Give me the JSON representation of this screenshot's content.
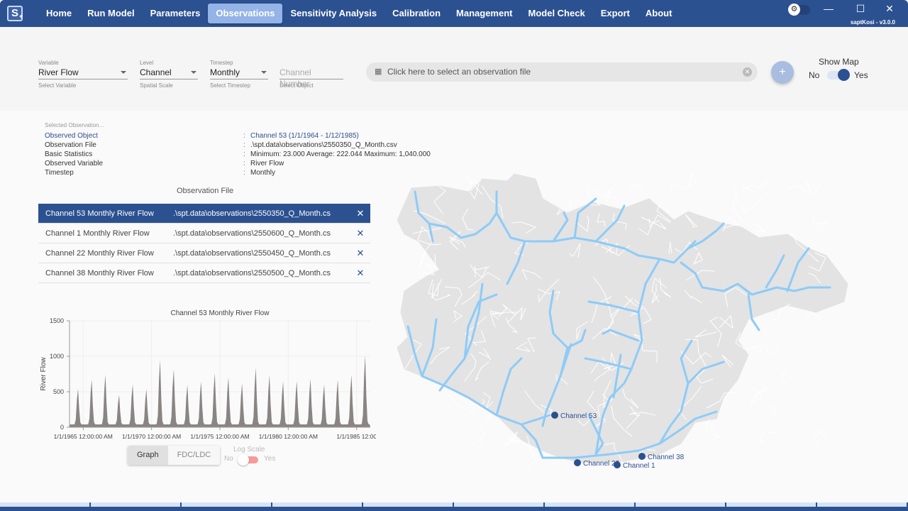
{
  "app": {
    "icon": "app-logo-s",
    "version_label": "saptKosi  - v3.0.0"
  },
  "nav": {
    "items": [
      {
        "label": "Home",
        "active": false
      },
      {
        "label": "Run Model",
        "active": false
      },
      {
        "label": "Parameters",
        "active": false
      },
      {
        "label": "Observations",
        "active": true
      },
      {
        "label": "Sensitivity Analysis",
        "active": false
      },
      {
        "label": "Calibration",
        "active": false
      },
      {
        "label": "Management",
        "active": false
      },
      {
        "label": "Model Check",
        "active": false
      },
      {
        "label": "Export",
        "active": false
      },
      {
        "label": "About",
        "active": false
      }
    ]
  },
  "window_controls": {
    "minimize": "—",
    "maximize": "☐",
    "close": "✕",
    "theme_icon": "gear-icon"
  },
  "filters": {
    "variable": {
      "label": "Variable",
      "value": "River Flow",
      "hint": "Select Variable"
    },
    "level": {
      "label": "Level",
      "value": "Channel",
      "hint": "Spatial Scale"
    },
    "timestep": {
      "label": "Timestep",
      "value": "Monthly",
      "hint": "Select Timestep"
    },
    "object": {
      "placeholder": "Channel Number",
      "hint": "Select Object"
    },
    "file_placeholder": "Click here to select an observation file",
    "add_label": "+",
    "show_map": {
      "label": "Show Map",
      "no": "No",
      "yes": "Yes",
      "value": true
    }
  },
  "selected": {
    "title": "Selected Observation...",
    "rows": [
      {
        "key": "Observed Object",
        "value": "Channel 53  (1/1/1964 - 1/12/1985)"
      },
      {
        "key": "Observation File",
        "value": ".\\spt.data\\observations\\2550350_Q_Month.csv"
      },
      {
        "key": "Basic Statistics",
        "value": "Minimum: 23.000 Average: 222.044 Maximum: 1,040.000"
      },
      {
        "key": "Observed Variable",
        "value": "River Flow"
      },
      {
        "key": "Timestep",
        "value": "Monthly"
      }
    ]
  },
  "obs_table": {
    "header": "Observation File",
    "rows": [
      {
        "name": "Channel 53 Monthly River Flow",
        "file": ".\\spt.data\\observations\\2550350_Q_Month.cs",
        "selected": true
      },
      {
        "name": "Channel 1 Monthly River Flow",
        "file": ".\\spt.data\\observations\\2550600_Q_Month.cs",
        "selected": false
      },
      {
        "name": "Channel 22 Monthly River Flow",
        "file": ".\\spt.data\\observations\\2550450_Q_Month.cs",
        "selected": false
      },
      {
        "name": "Channel 38 Monthly River Flow",
        "file": ".\\spt.data\\observations\\2550500_Q_Month.cs",
        "selected": false
      }
    ],
    "remove_icon": "✕"
  },
  "chart_controls": {
    "graph": "Graph",
    "fdc": "FDC/LDC",
    "log_label": "Log Scale",
    "log_no": "No",
    "log_yes": "Yes",
    "log_value": false
  },
  "chart_data": {
    "type": "area",
    "title": "Channel 53 Monthly River Flow",
    "xlabel": "",
    "ylabel": "River Flow",
    "ylim": [
      0,
      1500
    ],
    "yticks": [
      0,
      500,
      1000,
      1500
    ],
    "xticks": [
      "1/1/1965 12:00:00 AM",
      "1/1/1970 12:00:00 AM",
      "1/1/1975 12:00:00 AM",
      "1/1/1980 12:00:00 AM",
      "1/1/1985 12:00"
    ],
    "xtick_years": [
      1965,
      1970,
      1975,
      1980,
      1985
    ],
    "xrange_years": [
      1964.0,
      1986.0
    ],
    "grid": true,
    "color": "#8a8583",
    "annual_peaks": {
      "years": [
        1964,
        1965,
        1966,
        1967,
        1968,
        1969,
        1970,
        1971,
        1972,
        1973,
        1974,
        1975,
        1976,
        1977,
        1978,
        1979,
        1980,
        1981,
        1982,
        1983,
        1984,
        1985
      ],
      "peak_flow": [
        555,
        690,
        760,
        470,
        620,
        550,
        970,
        840,
        610,
        660,
        780,
        720,
        635,
        860,
        750,
        660,
        665,
        700,
        615,
        685,
        755,
        1040
      ],
      "base_flow": 40
    }
  },
  "map": {
    "stations": [
      {
        "label": "Channel 53"
      },
      {
        "label": "Channel 22"
      },
      {
        "label": "Channel 1"
      },
      {
        "label": "Channel 38"
      }
    ],
    "colors": {
      "basin": "#e3e3e3",
      "river": "#8ecbf7",
      "station": "#2c4f8f",
      "subbasin_line": "#ffffff"
    }
  },
  "bottom_tabs": 10
}
